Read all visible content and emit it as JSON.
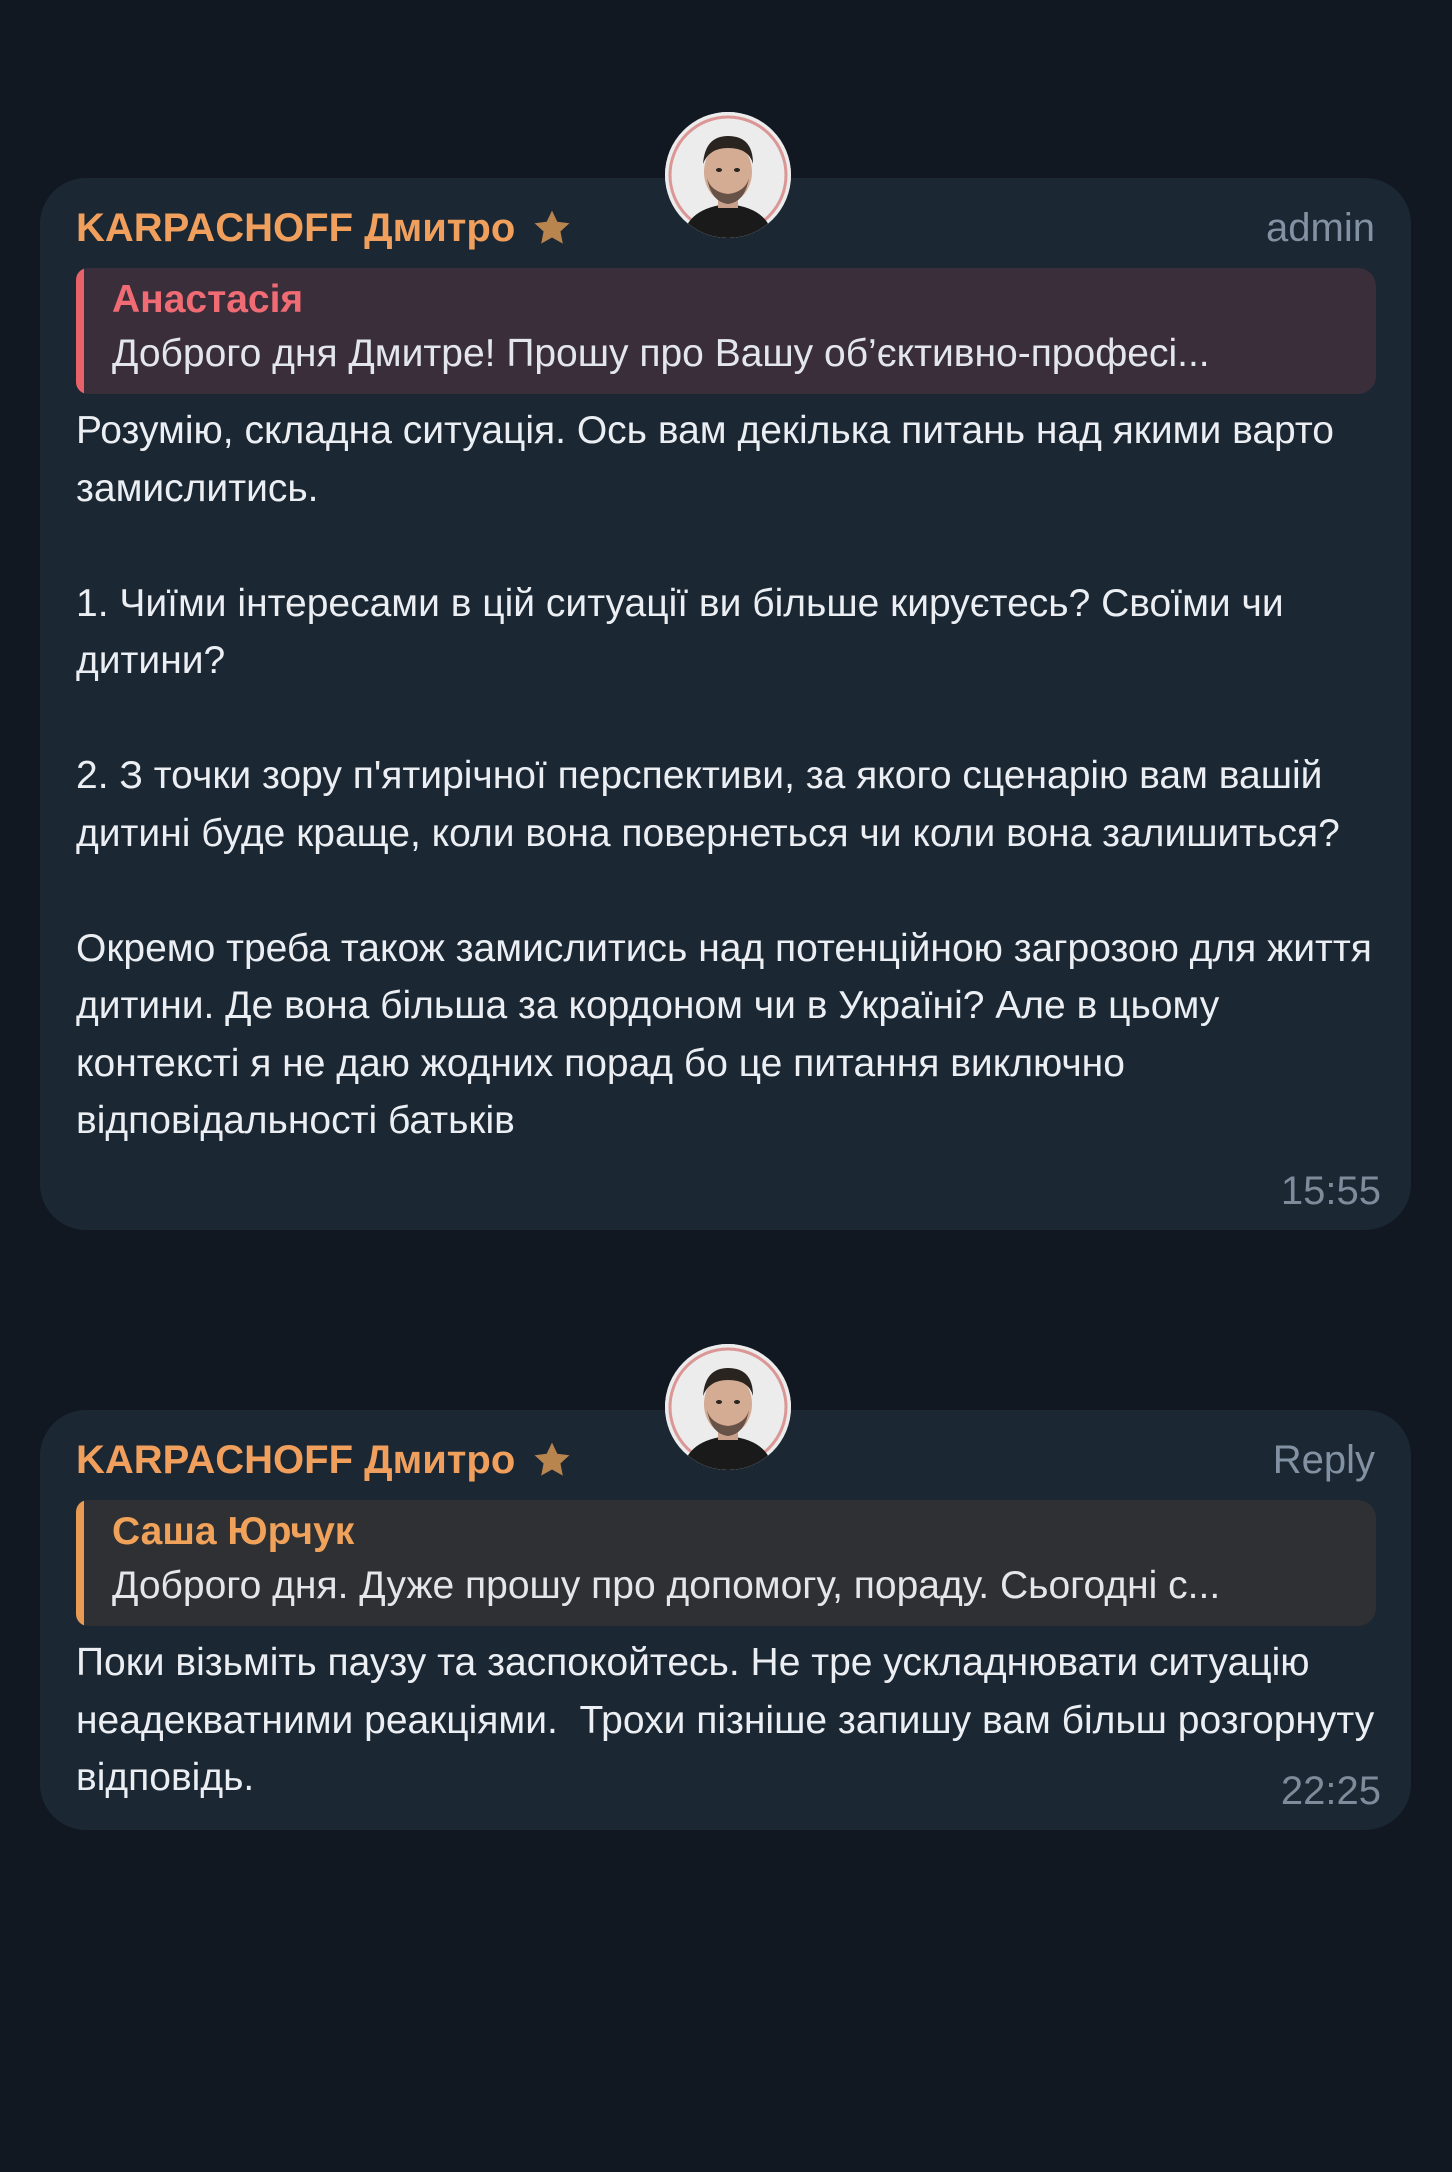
{
  "messages": [
    {
      "sender": "KARPACHOFF Дмитро",
      "tag": "admin",
      "avatar_icon": "avatar-man-portrait",
      "star_icon": "star-icon",
      "reply_to": {
        "name": "Анастасія",
        "text": "Доброго дня Дмитре! Прошу про Вашу об’єктивно-професі..."
      },
      "text": "Розумію, складна ситуація. Ось вам декілька питань над якими варто замислитись.\n\n1. Чиїми інтересами в цій ситуації ви більше кируєтесь? Своїми чи дитини?\n\n2. З точки зору п'ятирічної перспективи, за якого сценарію вам вашій дитині буде краще, коли вона повернеться чи коли вона залишиться?\n\nОкремо треба також замислитись над потенційною загрозою для життя дитини. Де вона більша за кордоном чи в Україні? Але в цьому контексті я не даю жодних порад бо це питання виключно відповідальності батьків",
      "time": "15:55"
    },
    {
      "sender": "KARPACHOFF Дмитро",
      "tag": "Reply",
      "avatar_icon": "avatar-man-portrait",
      "star_icon": "star-icon",
      "reply_to": {
        "name": "Саша Юрчук",
        "text": "Доброго дня. Дуже прошу про допомогу, пораду. Сьогодні с..."
      },
      "text": "Поки візьміть паузу та заспокойтесь. Не тре ускладнювати ситуацію неадекватними реакціями.  Трохи пізніше запишу вам більш розгорнуту відповідь.",
      "time": "22:25"
    }
  ],
  "colors": {
    "background": "#111822",
    "bubble": "#1b2733",
    "sender": "#f0a05c",
    "quote_1_accent": "#e8626a",
    "quote_2_accent": "#e99a53",
    "muted": "#7d8b9b"
  }
}
